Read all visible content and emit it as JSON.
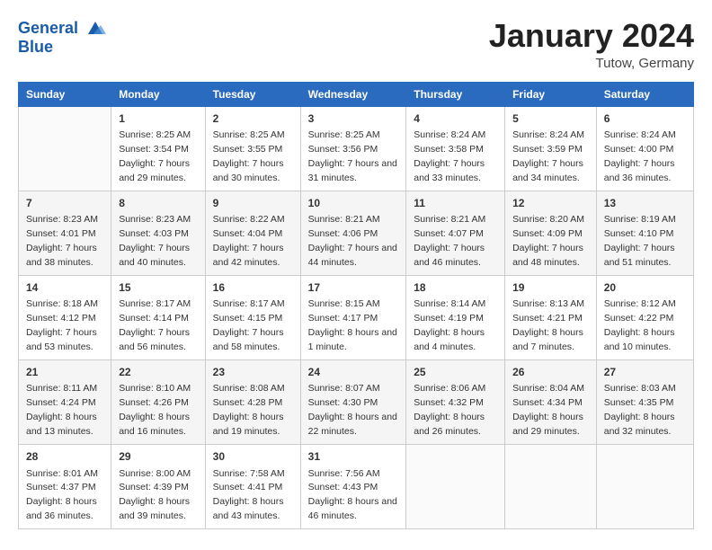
{
  "header": {
    "logo_line1": "General",
    "logo_line2": "Blue",
    "month": "January 2024",
    "location": "Tutow, Germany"
  },
  "columns": [
    "Sunday",
    "Monday",
    "Tuesday",
    "Wednesday",
    "Thursday",
    "Friday",
    "Saturday"
  ],
  "weeks": [
    [
      {
        "day": "",
        "sunrise": "",
        "sunset": "",
        "daylight": ""
      },
      {
        "day": "1",
        "sunrise": "Sunrise: 8:25 AM",
        "sunset": "Sunset: 3:54 PM",
        "daylight": "Daylight: 7 hours and 29 minutes."
      },
      {
        "day": "2",
        "sunrise": "Sunrise: 8:25 AM",
        "sunset": "Sunset: 3:55 PM",
        "daylight": "Daylight: 7 hours and 30 minutes."
      },
      {
        "day": "3",
        "sunrise": "Sunrise: 8:25 AM",
        "sunset": "Sunset: 3:56 PM",
        "daylight": "Daylight: 7 hours and 31 minutes."
      },
      {
        "day": "4",
        "sunrise": "Sunrise: 8:24 AM",
        "sunset": "Sunset: 3:58 PM",
        "daylight": "Daylight: 7 hours and 33 minutes."
      },
      {
        "day": "5",
        "sunrise": "Sunrise: 8:24 AM",
        "sunset": "Sunset: 3:59 PM",
        "daylight": "Daylight: 7 hours and 34 minutes."
      },
      {
        "day": "6",
        "sunrise": "Sunrise: 8:24 AM",
        "sunset": "Sunset: 4:00 PM",
        "daylight": "Daylight: 7 hours and 36 minutes."
      }
    ],
    [
      {
        "day": "7",
        "sunrise": "Sunrise: 8:23 AM",
        "sunset": "Sunset: 4:01 PM",
        "daylight": "Daylight: 7 hours and 38 minutes."
      },
      {
        "day": "8",
        "sunrise": "Sunrise: 8:23 AM",
        "sunset": "Sunset: 4:03 PM",
        "daylight": "Daylight: 7 hours and 40 minutes."
      },
      {
        "day": "9",
        "sunrise": "Sunrise: 8:22 AM",
        "sunset": "Sunset: 4:04 PM",
        "daylight": "Daylight: 7 hours and 42 minutes."
      },
      {
        "day": "10",
        "sunrise": "Sunrise: 8:21 AM",
        "sunset": "Sunset: 4:06 PM",
        "daylight": "Daylight: 7 hours and 44 minutes."
      },
      {
        "day": "11",
        "sunrise": "Sunrise: 8:21 AM",
        "sunset": "Sunset: 4:07 PM",
        "daylight": "Daylight: 7 hours and 46 minutes."
      },
      {
        "day": "12",
        "sunrise": "Sunrise: 8:20 AM",
        "sunset": "Sunset: 4:09 PM",
        "daylight": "Daylight: 7 hours and 48 minutes."
      },
      {
        "day": "13",
        "sunrise": "Sunrise: 8:19 AM",
        "sunset": "Sunset: 4:10 PM",
        "daylight": "Daylight: 7 hours and 51 minutes."
      }
    ],
    [
      {
        "day": "14",
        "sunrise": "Sunrise: 8:18 AM",
        "sunset": "Sunset: 4:12 PM",
        "daylight": "Daylight: 7 hours and 53 minutes."
      },
      {
        "day": "15",
        "sunrise": "Sunrise: 8:17 AM",
        "sunset": "Sunset: 4:14 PM",
        "daylight": "Daylight: 7 hours and 56 minutes."
      },
      {
        "day": "16",
        "sunrise": "Sunrise: 8:17 AM",
        "sunset": "Sunset: 4:15 PM",
        "daylight": "Daylight: 7 hours and 58 minutes."
      },
      {
        "day": "17",
        "sunrise": "Sunrise: 8:15 AM",
        "sunset": "Sunset: 4:17 PM",
        "daylight": "Daylight: 8 hours and 1 minute."
      },
      {
        "day": "18",
        "sunrise": "Sunrise: 8:14 AM",
        "sunset": "Sunset: 4:19 PM",
        "daylight": "Daylight: 8 hours and 4 minutes."
      },
      {
        "day": "19",
        "sunrise": "Sunrise: 8:13 AM",
        "sunset": "Sunset: 4:21 PM",
        "daylight": "Daylight: 8 hours and 7 minutes."
      },
      {
        "day": "20",
        "sunrise": "Sunrise: 8:12 AM",
        "sunset": "Sunset: 4:22 PM",
        "daylight": "Daylight: 8 hours and 10 minutes."
      }
    ],
    [
      {
        "day": "21",
        "sunrise": "Sunrise: 8:11 AM",
        "sunset": "Sunset: 4:24 PM",
        "daylight": "Daylight: 8 hours and 13 minutes."
      },
      {
        "day": "22",
        "sunrise": "Sunrise: 8:10 AM",
        "sunset": "Sunset: 4:26 PM",
        "daylight": "Daylight: 8 hours and 16 minutes."
      },
      {
        "day": "23",
        "sunrise": "Sunrise: 8:08 AM",
        "sunset": "Sunset: 4:28 PM",
        "daylight": "Daylight: 8 hours and 19 minutes."
      },
      {
        "day": "24",
        "sunrise": "Sunrise: 8:07 AM",
        "sunset": "Sunset: 4:30 PM",
        "daylight": "Daylight: 8 hours and 22 minutes."
      },
      {
        "day": "25",
        "sunrise": "Sunrise: 8:06 AM",
        "sunset": "Sunset: 4:32 PM",
        "daylight": "Daylight: 8 hours and 26 minutes."
      },
      {
        "day": "26",
        "sunrise": "Sunrise: 8:04 AM",
        "sunset": "Sunset: 4:34 PM",
        "daylight": "Daylight: 8 hours and 29 minutes."
      },
      {
        "day": "27",
        "sunrise": "Sunrise: 8:03 AM",
        "sunset": "Sunset: 4:35 PM",
        "daylight": "Daylight: 8 hours and 32 minutes."
      }
    ],
    [
      {
        "day": "28",
        "sunrise": "Sunrise: 8:01 AM",
        "sunset": "Sunset: 4:37 PM",
        "daylight": "Daylight: 8 hours and 36 minutes."
      },
      {
        "day": "29",
        "sunrise": "Sunrise: 8:00 AM",
        "sunset": "Sunset: 4:39 PM",
        "daylight": "Daylight: 8 hours and 39 minutes."
      },
      {
        "day": "30",
        "sunrise": "Sunrise: 7:58 AM",
        "sunset": "Sunset: 4:41 PM",
        "daylight": "Daylight: 8 hours and 43 minutes."
      },
      {
        "day": "31",
        "sunrise": "Sunrise: 7:56 AM",
        "sunset": "Sunset: 4:43 PM",
        "daylight": "Daylight: 8 hours and 46 minutes."
      },
      {
        "day": "",
        "sunrise": "",
        "sunset": "",
        "daylight": ""
      },
      {
        "day": "",
        "sunrise": "",
        "sunset": "",
        "daylight": ""
      },
      {
        "day": "",
        "sunrise": "",
        "sunset": "",
        "daylight": ""
      }
    ]
  ]
}
